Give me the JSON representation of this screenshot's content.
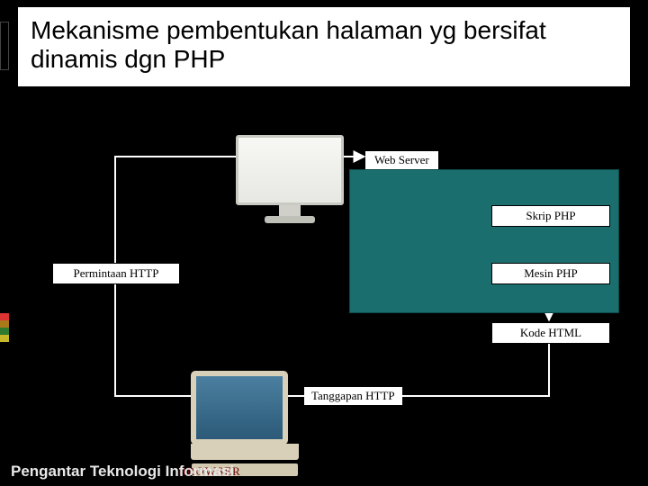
{
  "title": "Mekanisme pembentukan halaman yg bersifat dinamis dgn PHP",
  "labels": {
    "web_server": "Web Server",
    "skrip_php": "Skrip PHP",
    "mesin_php": "Mesin PHP",
    "kode_html": "Kode HTML",
    "permintaan": "Permintaan HTTP",
    "tanggapan": "Tanggapan HTTP",
    "browser": "BROWSER"
  },
  "footer": "Pengantar Teknologi Informasi",
  "accent_colors": [
    "#d33",
    "#aa7a1a",
    "#2e7a2e",
    "#c7b82a"
  ]
}
